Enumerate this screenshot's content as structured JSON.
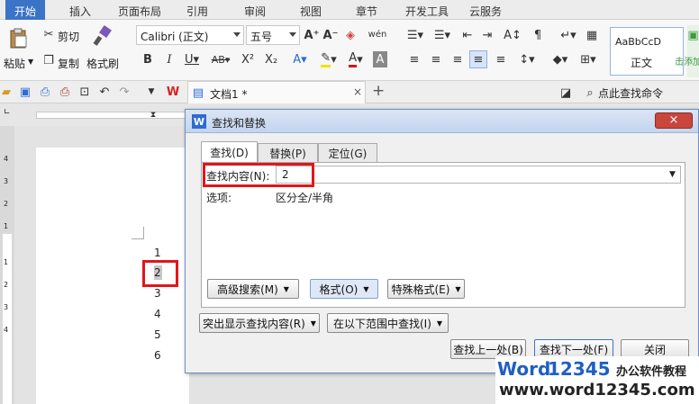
{
  "ribbon_tabs": [
    "开始",
    "插入",
    "页面布局",
    "引用",
    "审阅",
    "视图",
    "章节",
    "开发工具",
    "云服务"
  ],
  "clipboard": {
    "paste": "粘贴",
    "cut": "剪切",
    "copy": "复制",
    "format_painter": "格式刷"
  },
  "font": {
    "name": "Calibri (正文)",
    "size": "五号"
  },
  "style_gallery": {
    "sample": "AaBbCcD",
    "name": "正文"
  },
  "new_style": "击添加",
  "doc_tab": {
    "title": "文档1 *",
    "close": "×",
    "add": "+"
  },
  "search_command": "点此查找命令",
  "ruler_numbers": [
    "4",
    "3",
    "2",
    "1",
    "1",
    "2",
    "3",
    "4"
  ],
  "page_lines": [
    "1",
    "2",
    "3",
    "4",
    "5",
    "6"
  ],
  "dialog": {
    "title": "查找和替换",
    "close": "×",
    "tabs": [
      "查找(D)",
      "替换(P)",
      "定位(G)"
    ],
    "find_label": "查找内容(N):",
    "find_value": "2",
    "options_label": "选项:",
    "options_value": "区分全/半角",
    "advanced_search": "高级搜索(M)",
    "format": "格式(O)",
    "special_format": "特殊格式(E)",
    "highlight": "突出显示查找内容(R)",
    "find_in": "在以下范围中查找(I)",
    "find_prev": "查找上一处(B)",
    "find_next": "查找下一处(F)",
    "close_button": "关闭"
  },
  "watermark": {
    "brand_word": "Word",
    "brand_number": "12345",
    "tagline": "办公软件教程",
    "url": "www.word12345.com"
  },
  "colors": {
    "accent": "#3b73c6",
    "highlight_red": "#e0161b",
    "watermark_blue": "#1e5fc4"
  }
}
